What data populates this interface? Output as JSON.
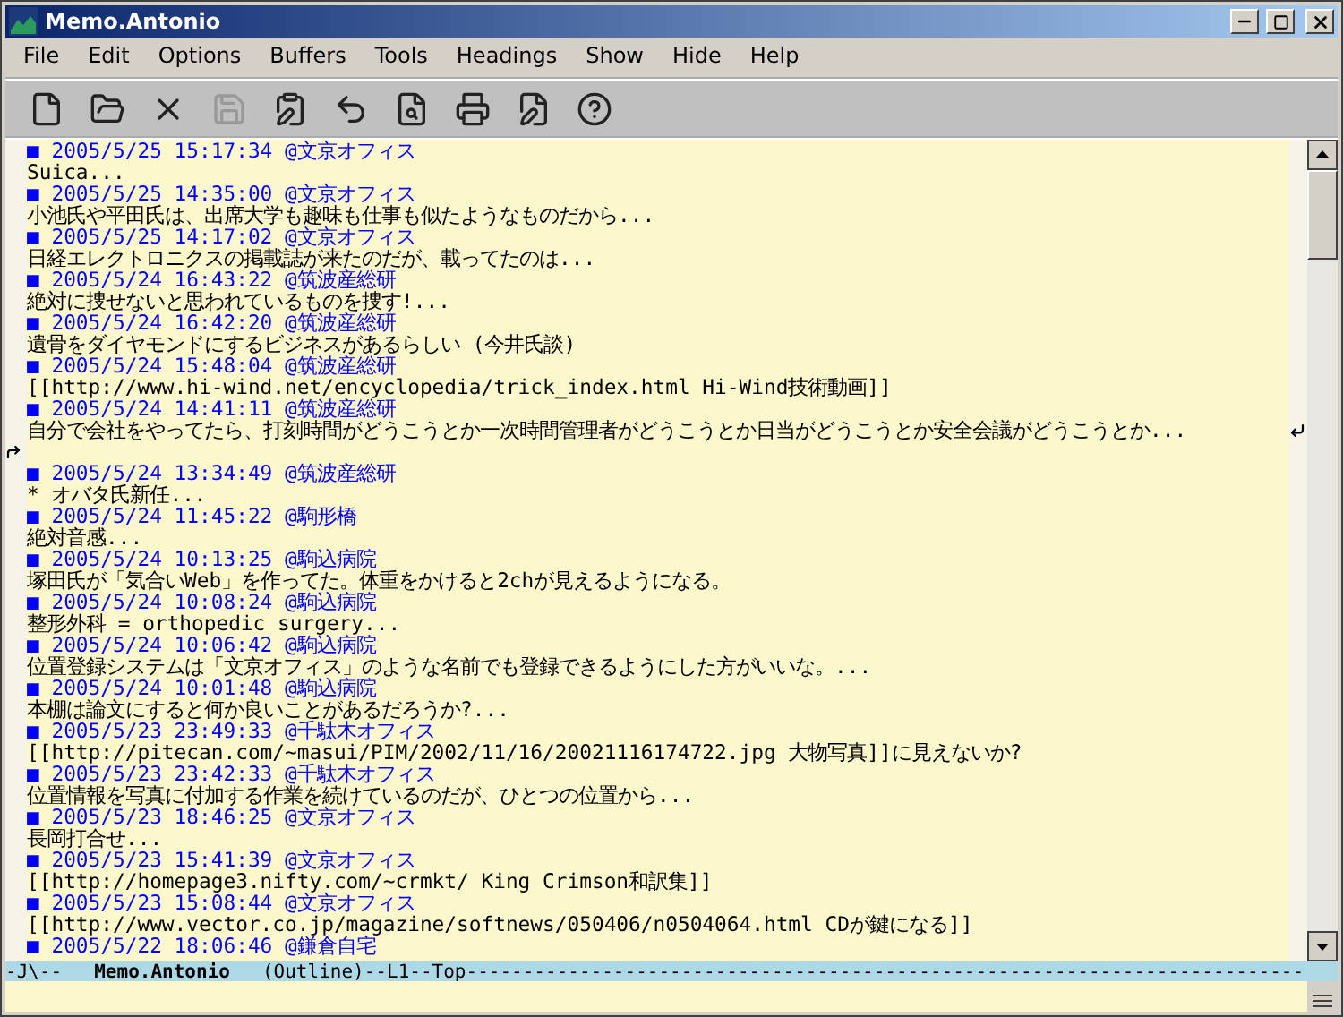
{
  "window": {
    "title": "Memo.Antonio"
  },
  "menu": [
    "File",
    "Edit",
    "Options",
    "Buffers",
    "Tools",
    "Headings",
    "Show",
    "Hide",
    "Help"
  ],
  "toolbar": [
    {
      "kind": "new",
      "disabled": false
    },
    {
      "kind": "open",
      "disabled": false
    },
    {
      "kind": "close",
      "disabled": false
    },
    {
      "kind": "save",
      "disabled": true
    },
    {
      "kind": "edit",
      "disabled": false
    },
    {
      "kind": "undo",
      "disabled": false
    },
    {
      "kind": "search",
      "disabled": false
    },
    {
      "kind": "print",
      "disabled": false
    },
    {
      "kind": "check",
      "disabled": false
    },
    {
      "kind": "help",
      "disabled": false
    }
  ],
  "entries": [
    {
      "heading": "■ 2005/5/25 15:17:34 @文京オフィス",
      "body": "Suica..."
    },
    {
      "heading": "■ 2005/5/25 14:35:00 @文京オフィス",
      "body": "小池氏や平田氏は、出席大学も趣味も仕事も似たようなものだから..."
    },
    {
      "heading": "■ 2005/5/25 14:17:02 @文京オフィス",
      "body": "日経エレクトロニクスの掲載誌が来たのだが、載ってたのは..."
    },
    {
      "heading": "■ 2005/5/24 16:43:22 @筑波産総研",
      "body": "絶対に捜せないと思われているものを捜す!..."
    },
    {
      "heading": "■ 2005/5/24 16:42:20 @筑波産総研",
      "body": "遺骨をダイヤモンドにするビジネスがあるらしい (今井氏談)"
    },
    {
      "heading": "■ 2005/5/24 15:48:04 @筑波産総研",
      "body": "[[http://www.hi-wind.net/encyclopedia/trick_index.html Hi-Wind技術動画]]"
    },
    {
      "heading": "■ 2005/5/24 14:41:11 @筑波産総研",
      "body": "自分で会社をやってたら、打刻時間がどうこうとか一次時間管理者がどうこうとか日当がどうこうとか安全会議がどうこうとか...",
      "wrapped": true
    },
    {
      "heading": "■ 2005/5/24 13:34:49 @筑波産総研",
      "body": "* オバタ氏新任..."
    },
    {
      "heading": "■ 2005/5/24 11:45:22 @駒形橋",
      "body": "絶対音感..."
    },
    {
      "heading": "■ 2005/5/24 10:13:25 @駒込病院",
      "body": "塚田氏が「気合いWeb」を作ってた。体重をかけると2chが見えるようになる。"
    },
    {
      "heading": "■ 2005/5/24 10:08:24 @駒込病院",
      "body": "整形外科 = orthopedic surgery..."
    },
    {
      "heading": "■ 2005/5/24 10:06:42 @駒込病院",
      "body": "位置登録システムは「文京オフィス」のような名前でも登録できるようにした方がいいな。..."
    },
    {
      "heading": "■ 2005/5/24 10:01:48 @駒込病院",
      "body": "本棚は論文にすると何か良いことがあるだろうか?..."
    },
    {
      "heading": "■ 2005/5/23 23:49:33 @千駄木オフィス",
      "body": "[[http://pitecan.com/~masui/PIM/2002/11/16/20021116174722.jpg 大物写真]]に見えないか?"
    },
    {
      "heading": "■ 2005/5/23 23:42:33 @千駄木オフィス",
      "body": "位置情報を写真に付加する作業を続けているのだが、ひとつの位置から..."
    },
    {
      "heading": "■ 2005/5/23 18:46:25 @文京オフィス",
      "body": "長岡打合せ..."
    },
    {
      "heading": "■ 2005/5/23 15:41:39 @文京オフィス",
      "body": "[[http://homepage3.nifty.com/~crmkt/ King Crimson和訳集]]"
    },
    {
      "heading": "■ 2005/5/23 15:08:44 @文京オフィス",
      "body": "[[http://www.vector.co.jp/magazine/softnews/050406/n0504064.html CDが鍵になる]]"
    },
    {
      "heading": "■ 2005/5/22 18:06:46 @鎌倉自宅"
    }
  ],
  "mode_line": {
    "status": "-J\\--",
    "buffer": "Memo.Antonio",
    "mode": "(Outline)--L1--Top--------------------------------------------------------------------------"
  }
}
